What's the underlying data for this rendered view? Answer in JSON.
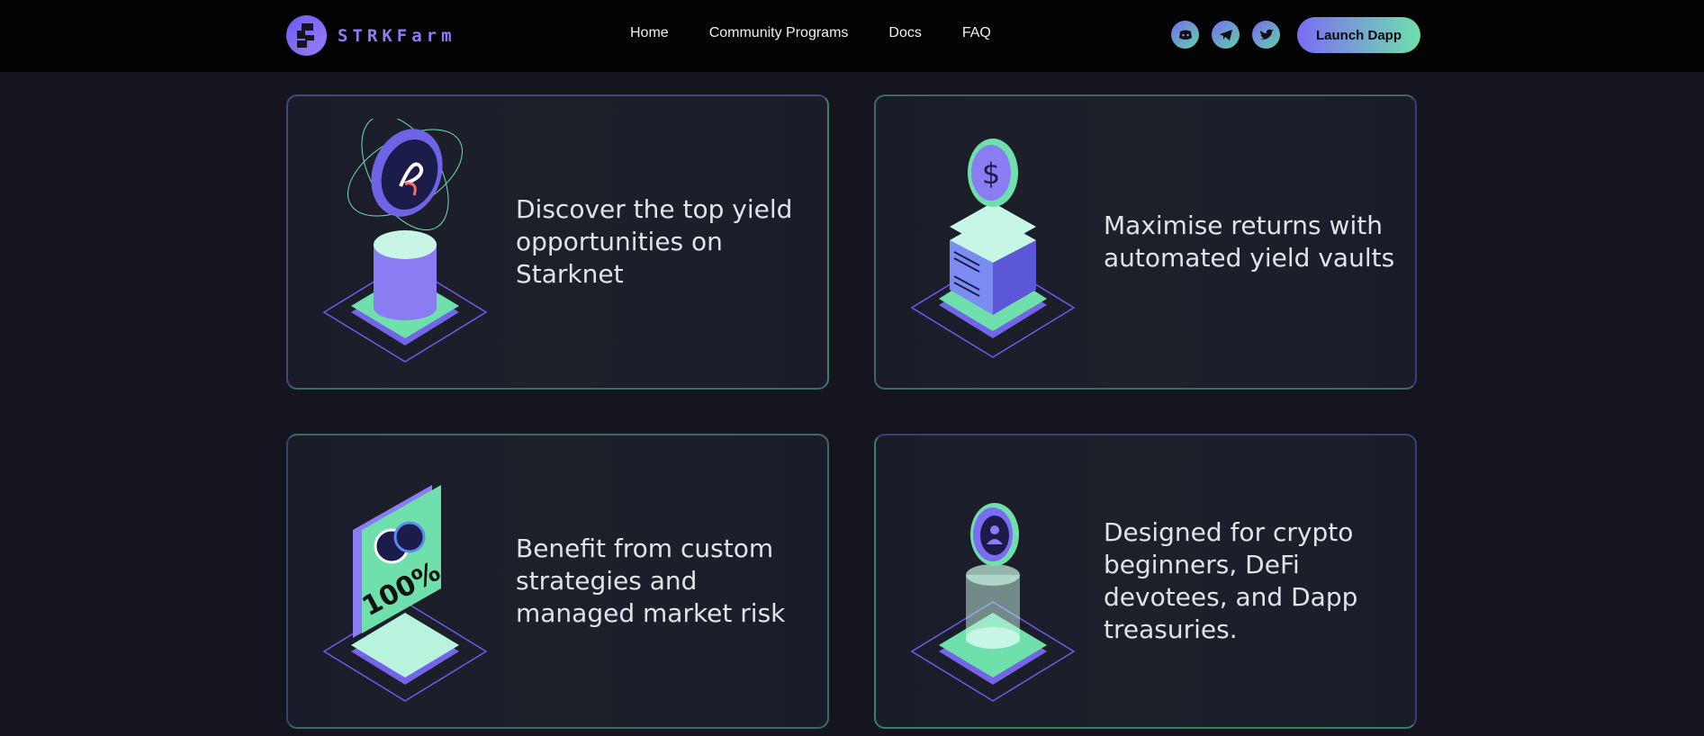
{
  "header": {
    "logo_text": "STRKFarm",
    "nav": [
      "Home",
      "Community Programs",
      "Docs",
      "FAQ"
    ],
    "socials": [
      "discord-icon",
      "telegram-icon",
      "twitter-icon"
    ],
    "launch_label": "Launch Dapp"
  },
  "features": [
    {
      "text": "Discover the top yield opportunities on Starknet",
      "illustration": "orbiting-coin-on-pedestal"
    },
    {
      "text": "Maximise returns with automated yield vaults",
      "illustration": "dollar-coin-on-server"
    },
    {
      "text": "Benefit from custom strategies and managed market risk",
      "illustration": "100-percent-card"
    },
    {
      "text": "Designed for crypto beginners, DeFi devotees, and Dapp treasuries.",
      "illustration": "user-coin-on-pedestal"
    }
  ],
  "colors": {
    "background": "#14151f",
    "header": "#030303",
    "accent_purple": "#7c6cf3",
    "accent_green": "#6fe0ac"
  }
}
